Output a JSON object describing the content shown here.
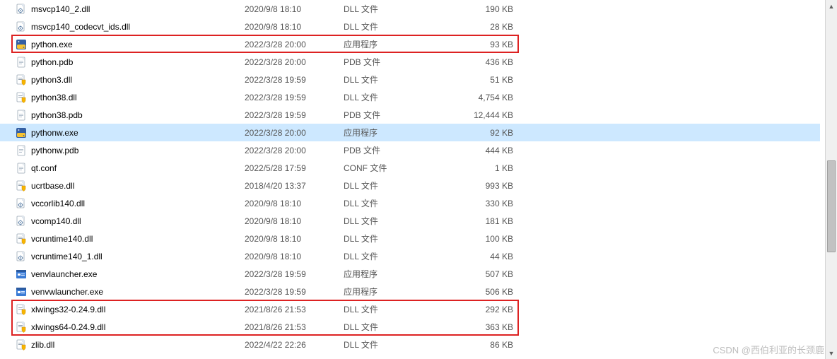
{
  "watermark": "CSDN @西伯利亚的长颈鹿",
  "files": [
    {
      "name": "msvcp140_2.dll",
      "date": "2020/9/8 18:10",
      "type": "DLL 文件",
      "size": "190 KB",
      "icon": "dll",
      "selected": false,
      "highlight": false
    },
    {
      "name": "msvcp140_codecvt_ids.dll",
      "date": "2020/9/8 18:10",
      "type": "DLL 文件",
      "size": "28 KB",
      "icon": "dll",
      "selected": false,
      "highlight": false
    },
    {
      "name": "python.exe",
      "date": "2022/3/28 20:00",
      "type": "应用程序",
      "size": "93 KB",
      "icon": "python",
      "selected": false,
      "highlight": true
    },
    {
      "name": "python.pdb",
      "date": "2022/3/28 20:00",
      "type": "PDB 文件",
      "size": "436 KB",
      "icon": "file",
      "selected": false,
      "highlight": false
    },
    {
      "name": "python3.dll",
      "date": "2022/3/28 19:59",
      "type": "DLL 文件",
      "size": "51 KB",
      "icon": "dll-shield",
      "selected": false,
      "highlight": false
    },
    {
      "name": "python38.dll",
      "date": "2022/3/28 19:59",
      "type": "DLL 文件",
      "size": "4,754 KB",
      "icon": "dll-shield",
      "selected": false,
      "highlight": false
    },
    {
      "name": "python38.pdb",
      "date": "2022/3/28 19:59",
      "type": "PDB 文件",
      "size": "12,444 KB",
      "icon": "file",
      "selected": false,
      "highlight": false
    },
    {
      "name": "pythonw.exe",
      "date": "2022/3/28 20:00",
      "type": "应用程序",
      "size": "92 KB",
      "icon": "python",
      "selected": true,
      "highlight": false
    },
    {
      "name": "pythonw.pdb",
      "date": "2022/3/28 20:00",
      "type": "PDB 文件",
      "size": "444 KB",
      "icon": "file",
      "selected": false,
      "highlight": false
    },
    {
      "name": "qt.conf",
      "date": "2022/5/28 17:59",
      "type": "CONF 文件",
      "size": "1 KB",
      "icon": "file",
      "selected": false,
      "highlight": false
    },
    {
      "name": "ucrtbase.dll",
      "date": "2018/4/20 13:37",
      "type": "DLL 文件",
      "size": "993 KB",
      "icon": "dll-shield",
      "selected": false,
      "highlight": false
    },
    {
      "name": "vccorlib140.dll",
      "date": "2020/9/8 18:10",
      "type": "DLL 文件",
      "size": "330 KB",
      "icon": "dll",
      "selected": false,
      "highlight": false
    },
    {
      "name": "vcomp140.dll",
      "date": "2020/9/8 18:10",
      "type": "DLL 文件",
      "size": "181 KB",
      "icon": "dll",
      "selected": false,
      "highlight": false
    },
    {
      "name": "vcruntime140.dll",
      "date": "2020/9/8 18:10",
      "type": "DLL 文件",
      "size": "100 KB",
      "icon": "dll-shield",
      "selected": false,
      "highlight": false
    },
    {
      "name": "vcruntime140_1.dll",
      "date": "2020/9/8 18:10",
      "type": "DLL 文件",
      "size": "44 KB",
      "icon": "dll",
      "selected": false,
      "highlight": false
    },
    {
      "name": "venvlauncher.exe",
      "date": "2022/3/28 19:59",
      "type": "应用程序",
      "size": "507 KB",
      "icon": "exe",
      "selected": false,
      "highlight": false
    },
    {
      "name": "venvwlauncher.exe",
      "date": "2022/3/28 19:59",
      "type": "应用程序",
      "size": "506 KB",
      "icon": "exe",
      "selected": false,
      "highlight": false
    },
    {
      "name": "xlwings32-0.24.9.dll",
      "date": "2021/8/26 21:53",
      "type": "DLL 文件",
      "size": "292 KB",
      "icon": "dll-shield",
      "selected": false,
      "highlight": true
    },
    {
      "name": "xlwings64-0.24.9.dll",
      "date": "2021/8/26 21:53",
      "type": "DLL 文件",
      "size": "363 KB",
      "icon": "dll-shield",
      "selected": false,
      "highlight": true
    },
    {
      "name": "zlib.dll",
      "date": "2022/4/22 22:26",
      "type": "DLL 文件",
      "size": "86 KB",
      "icon": "dll-shield",
      "selected": false,
      "highlight": false
    }
  ]
}
